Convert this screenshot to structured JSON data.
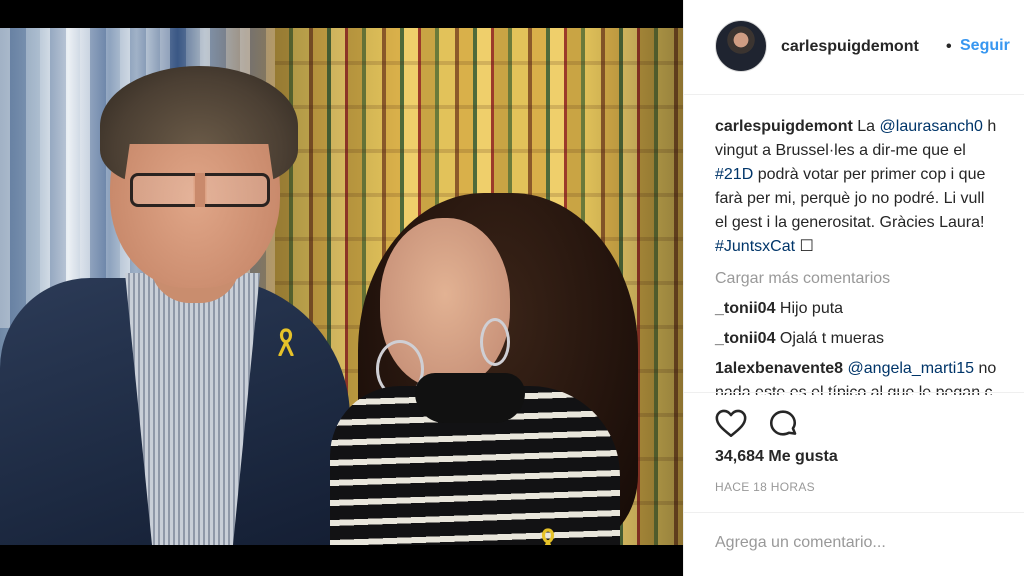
{
  "post": {
    "username": "carlespuigdemont",
    "dot": "•",
    "follow_label": "Seguir"
  },
  "caption": {
    "username": "carlespuigdemont",
    "line1_pre": "La ",
    "mention": "@laurasanch0",
    "line1_post": " h",
    "line2": "vingut a Brussel·les a dir-me que el",
    "hashtag1": "#21D",
    "line3_post": " podrà votar per primer cop i que",
    "line4": "farà per mi, perquè jo no podré. Li vull",
    "line5": "el gest i la generositat. Gràcies Laura!",
    "hashtag2": "#JuntsxCat",
    "emoji_box": "☐"
  },
  "load_more": "Cargar más comentarios",
  "comments": [
    {
      "username": "_tonii04",
      "text": "Hijo puta"
    },
    {
      "username": "_tonii04",
      "text": "Ojalá t mueras"
    },
    {
      "username": "1alexbenavente8",
      "mention": "@angela_marti15",
      "text": " no",
      "cut_line": "nada este es el típico al que le pegan c"
    }
  ],
  "likes": "34,684 Me gusta",
  "timestamp": "HACE 18 HORAS",
  "add_comment_placeholder": "Agrega un comentario...",
  "icons": {
    "like": "heart-icon",
    "comment": "comment-bubble-icon",
    "ribbon": "yellow-ribbon-icon"
  },
  "colors": {
    "link": "#003569",
    "follow": "#3897f0",
    "muted": "#999999",
    "ribbon": "#e6c229"
  }
}
